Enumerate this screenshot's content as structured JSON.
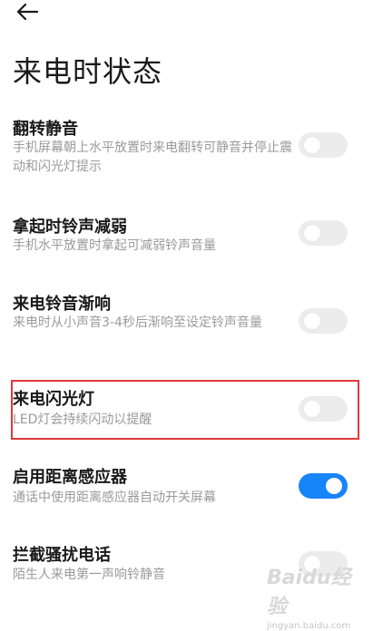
{
  "header": {
    "title": "来电时状态"
  },
  "settings": [
    {
      "title": "翻转静音",
      "desc": "手机屏幕朝上水平放置时来电翻转可静音并停止震动和闪光灯提示",
      "enabled": false
    },
    {
      "title": "拿起时铃声减弱",
      "desc": "手机水平放置时拿起可减弱铃声音量",
      "enabled": false
    },
    {
      "title": "来电铃音渐响",
      "desc": "来电时从小声音3-4秒后渐响至设定铃声音量",
      "enabled": false
    },
    {
      "title": "来电闪光灯",
      "desc": "LED灯会持续闪动以提醒",
      "enabled": false
    },
    {
      "title": "启用距离感应器",
      "desc": "通话中使用距离感应器自动开关屏幕",
      "enabled": true
    },
    {
      "title": "拦截骚扰电话",
      "desc": "陌生人来电第一声响铃静音",
      "enabled": false
    }
  ],
  "watermark": {
    "logo": "Baidu经验",
    "url": "jingyan.baidu.com"
  },
  "colors": {
    "toggle_on": "#1784f9",
    "toggle_off": "#ececec",
    "highlight": "#e2383a"
  }
}
